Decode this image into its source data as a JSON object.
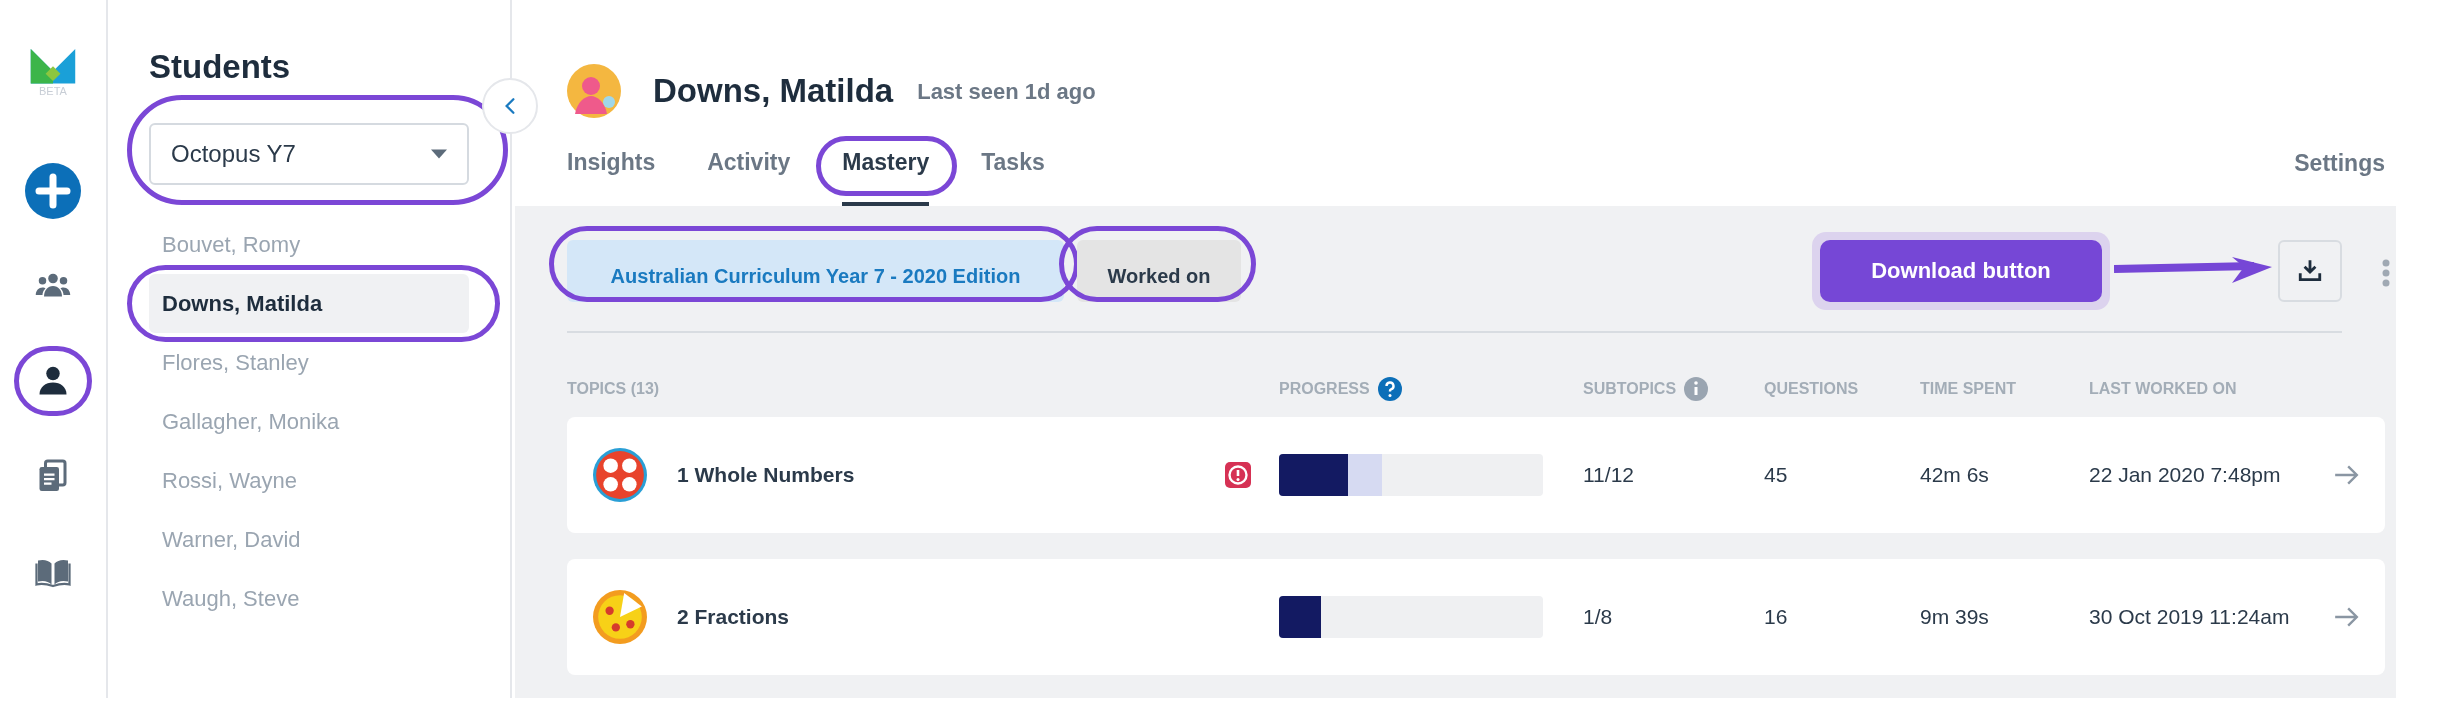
{
  "logo": {
    "badge": "BETA"
  },
  "rail": [
    {
      "kind": "add",
      "selected": false,
      "highlighted": false
    },
    {
      "kind": "classes",
      "selected": false,
      "highlighted": false
    },
    {
      "kind": "students",
      "selected": true,
      "highlighted": true
    },
    {
      "kind": "tasks",
      "selected": false,
      "highlighted": false
    },
    {
      "kind": "library",
      "selected": false,
      "highlighted": false
    }
  ],
  "students_panel": {
    "title": "Students",
    "class_select": {
      "value": "Octopus Y7",
      "highlighted": true
    },
    "items": [
      {
        "label": "Bouvet, Romy",
        "selected": false,
        "highlighted": false
      },
      {
        "label": "Downs, Matilda",
        "selected": true,
        "highlighted": true
      },
      {
        "label": "Flores, Stanley",
        "selected": false,
        "highlighted": false
      },
      {
        "label": "Gallagher, Monika",
        "selected": false,
        "highlighted": false
      },
      {
        "label": "Rossi, Wayne",
        "selected": false,
        "highlighted": false
      },
      {
        "label": "Warner, David",
        "selected": false,
        "highlighted": false
      },
      {
        "label": "Waugh, Steve",
        "selected": false,
        "highlighted": false
      }
    ]
  },
  "student": {
    "name": "Downs, Matilda",
    "last_seen": "Last seen 1d ago"
  },
  "tabs": [
    {
      "label": "Insights",
      "selected": false,
      "highlighted": false
    },
    {
      "label": "Activity",
      "selected": false,
      "highlighted": false
    },
    {
      "label": "Mastery",
      "selected": true,
      "highlighted": true
    },
    {
      "label": "Tasks",
      "selected": false,
      "highlighted": false
    }
  ],
  "settings_link": "Settings",
  "filters": [
    {
      "label": "Australian Curriculum Year 7 - 2020 Edition",
      "selected": true,
      "highlighted": true
    },
    {
      "label": "Worked on",
      "selected": false,
      "highlighted": true
    }
  ],
  "callout": {
    "text": "Download button"
  },
  "table": {
    "columns": [
      {
        "label": "TOPICS (13)",
        "kind": "plain"
      },
      {
        "label": "PROGRESS",
        "kind": "help"
      },
      {
        "label": "SUBTOPICS",
        "kind": "info"
      },
      {
        "label": "QUESTIONS",
        "kind": "plain"
      },
      {
        "label": "TIME SPENT",
        "kind": "plain"
      },
      {
        "label": "LAST WORKED ON",
        "kind": "plain"
      }
    ],
    "rows": [
      {
        "kind": "numbers",
        "topic": "1 Whole Numbers",
        "flagged": true,
        "progress": [
          {
            "kind": "mastered",
            "level": 0.26
          },
          {
            "kind": "attempted",
            "level": 0.39
          }
        ],
        "subtopics": "11/12",
        "questions": "45",
        "time_spent": "42m 6s",
        "last_worked_on": "22 Jan 2020 7:48pm"
      },
      {
        "kind": "pizza",
        "topic": "2 Fractions",
        "flagged": false,
        "progress": [
          {
            "kind": "mastered",
            "level": 0.16
          }
        ],
        "subtopics": "1/8",
        "questions": "16",
        "time_spent": "9m 39s",
        "last_worked_on": "30 Oct 2019 11:24am"
      }
    ]
  }
}
